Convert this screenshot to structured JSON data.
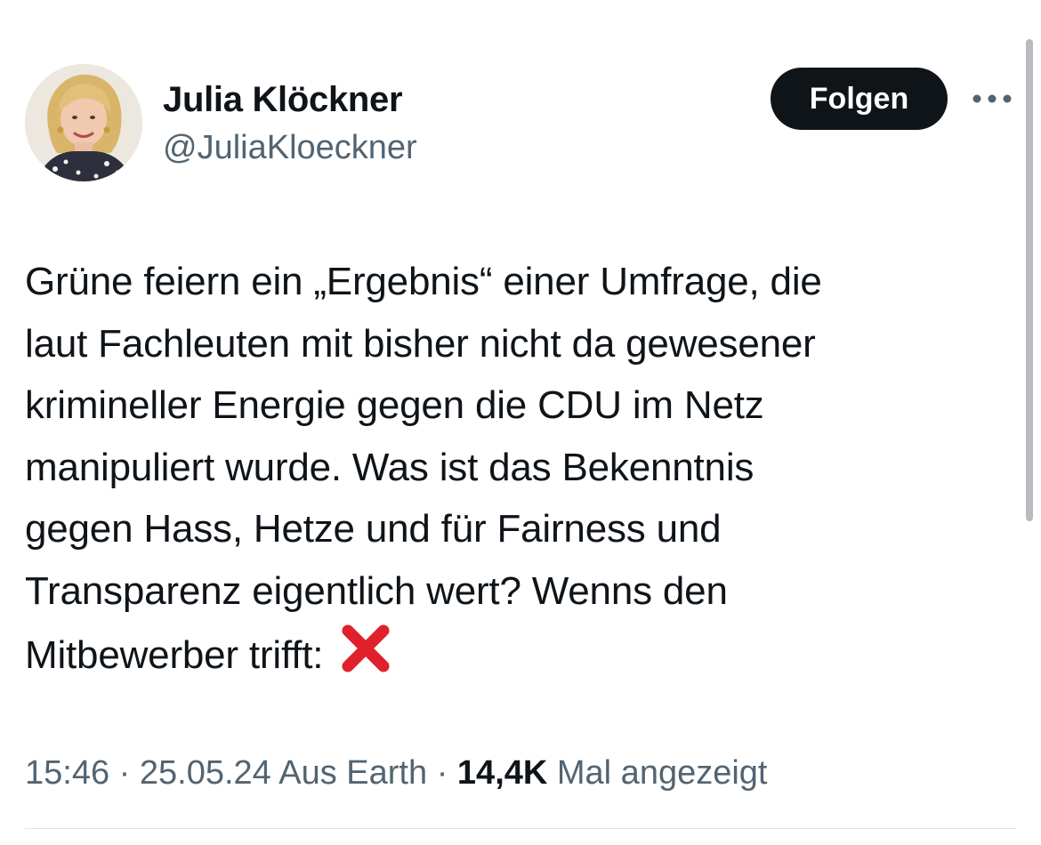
{
  "author": {
    "display_name": "Julia Klöckner",
    "handle": "@JuliaKloeckner"
  },
  "header": {
    "follow_label": "Folgen",
    "more_icon": "ellipsis-icon"
  },
  "tweet": {
    "text": "Grüne feiern ein „Ergebnis“ einer Umfrage, die\nlaut Fachleuten mit bisher nicht da gewesener\nkrimineller Energie gegen die CDU im Netz\nmanipuliert wurde. Was ist das Bekenntnis\ngegen Hass, Hetze und für Fairness und\nTransparenz eigentlich wert? Wenns den\nMitbewerber trifft:",
    "emoji": "cross-mark-icon"
  },
  "meta": {
    "time": "15:46",
    "separator": "·",
    "date": "25.05.24",
    "source": "Aus Earth",
    "views_count": "14,4K",
    "views_label": "Mal angezeigt"
  },
  "colors": {
    "text_primary": "#0f1419",
    "text_secondary": "#536471",
    "follow_button_bg": "#0f1419",
    "cross_mark": "#e0202b"
  }
}
